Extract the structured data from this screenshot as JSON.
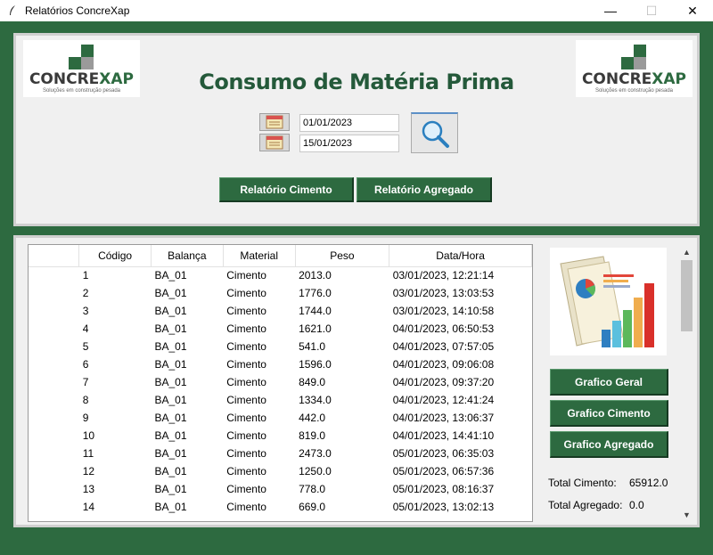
{
  "window": {
    "title": "Relatórios ConcreXap",
    "minimize": "—",
    "maximize": "☐",
    "close": "✕"
  },
  "logo": {
    "word_a": "CONCRE",
    "word_b": "XAP",
    "tagline": "Soluções em construção pesada"
  },
  "header": {
    "title": "Consumo de Matéria Prima"
  },
  "filters": {
    "start_date": "01/01/2023",
    "end_date": "15/01/2023"
  },
  "buttons": {
    "cimento": "Relatório Cimento",
    "agregado": "Relatório Agregado",
    "grafico_geral": "Grafico Geral",
    "grafico_cimento": "Grafico Cimento",
    "grafico_agregado": "Grafico Agregado"
  },
  "table": {
    "columns": [
      "Código",
      "Balança",
      "Material",
      "Peso",
      "Data/Hora"
    ],
    "rows": [
      [
        "1",
        "BA_01",
        "Cimento",
        "2013.0",
        "03/01/2023, 12:21:14"
      ],
      [
        "2",
        "BA_01",
        "Cimento",
        "1776.0",
        "03/01/2023, 13:03:53"
      ],
      [
        "3",
        "BA_01",
        "Cimento",
        "1744.0",
        "03/01/2023, 14:10:58"
      ],
      [
        "4",
        "BA_01",
        "Cimento",
        "1621.0",
        "04/01/2023, 06:50:53"
      ],
      [
        "5",
        "BA_01",
        "Cimento",
        "541.0",
        "04/01/2023, 07:57:05"
      ],
      [
        "6",
        "BA_01",
        "Cimento",
        "1596.0",
        "04/01/2023, 09:06:08"
      ],
      [
        "7",
        "BA_01",
        "Cimento",
        "849.0",
        "04/01/2023, 09:37:20"
      ],
      [
        "8",
        "BA_01",
        "Cimento",
        "1334.0",
        "04/01/2023, 12:41:24"
      ],
      [
        "9",
        "BA_01",
        "Cimento",
        "442.0",
        "04/01/2023, 13:06:37"
      ],
      [
        "10",
        "BA_01",
        "Cimento",
        "819.0",
        "04/01/2023, 14:41:10"
      ],
      [
        "11",
        "BA_01",
        "Cimento",
        "2473.0",
        "05/01/2023, 06:35:03"
      ],
      [
        "12",
        "BA_01",
        "Cimento",
        "1250.0",
        "05/01/2023, 06:57:36"
      ],
      [
        "13",
        "BA_01",
        "Cimento",
        "778.0",
        "05/01/2023, 08:16:37"
      ],
      [
        "14",
        "BA_01",
        "Cimento",
        "669.0",
        "05/01/2023, 13:02:13"
      ]
    ]
  },
  "totals": {
    "cimento_label": "Total Cimento:",
    "cimento_value": "65912.0",
    "agregado_label": "Total Agregado:",
    "agregado_value": "0.0"
  },
  "colors": {
    "brand_green": "#2d6a40",
    "heading_green": "#24593a"
  }
}
